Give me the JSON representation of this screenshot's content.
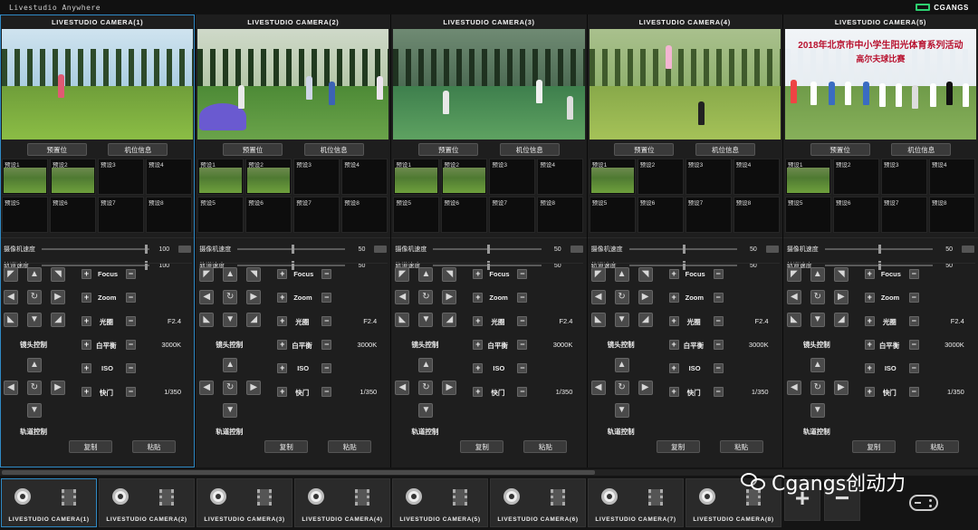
{
  "app": {
    "title": "Livestudio Anywhere",
    "brand": "CGANGS"
  },
  "cameras": [
    {
      "title": "LIVESTUDIO CAMERA(1)",
      "preset_btn": "预置位",
      "info_btn": "机位信息",
      "presets": [
        "预设1",
        "预设2",
        "预设3",
        "预设4",
        "预设5",
        "预设6",
        "预设7",
        "预设8"
      ],
      "speed_label": "摄像机速度",
      "speed_value": "100",
      "track_label": "轨道速度",
      "track_value": "100",
      "focus": "Focus",
      "zoom": "Zoom",
      "iris": "光圈",
      "iris_value": "F2.4",
      "wb": "白平衡",
      "wb_value": "3000K",
      "iso": "ISO",
      "shutter": "快门",
      "shutter_value": "1/350",
      "lens_ctrl": "镜头控制",
      "track_ctrl": "轨道控制",
      "copy": "复制",
      "paste": "粘贴"
    },
    {
      "title": "LIVESTUDIO CAMERA(2)",
      "preset_btn": "预置位",
      "info_btn": "机位信息",
      "presets": [
        "预设1",
        "预设2",
        "预设3",
        "预设4",
        "预设5",
        "预设6",
        "预设7",
        "预设8"
      ],
      "speed_label": "摄像机速度",
      "speed_value": "50",
      "track_label": "轨道速度",
      "track_value": "50",
      "focus": "Focus",
      "zoom": "Zoom",
      "iris": "光圈",
      "iris_value": "F2.4",
      "wb": "白平衡",
      "wb_value": "3000K",
      "iso": "ISO",
      "shutter": "快门",
      "shutter_value": "1/350",
      "lens_ctrl": "镜头控制",
      "track_ctrl": "轨道控制",
      "copy": "复制",
      "paste": "粘贴"
    },
    {
      "title": "LIVESTUDIO CAMERA(3)",
      "preset_btn": "预置位",
      "info_btn": "机位信息",
      "presets": [
        "预设1",
        "预设2",
        "预设3",
        "预设4",
        "预设5",
        "预设6",
        "预设7",
        "预设8"
      ],
      "speed_label": "摄像机速度",
      "speed_value": "50",
      "track_label": "轨道速度",
      "track_value": "50",
      "focus": "Focus",
      "zoom": "Zoom",
      "iris": "光圈",
      "iris_value": "F2.4",
      "wb": "白平衡",
      "wb_value": "3000K",
      "iso": "ISO",
      "shutter": "快门",
      "shutter_value": "1/350",
      "lens_ctrl": "镜头控制",
      "track_ctrl": "轨道控制",
      "copy": "复制",
      "paste": "粘贴"
    },
    {
      "title": "LIVESTUDIO CAMERA(4)",
      "preset_btn": "预置位",
      "info_btn": "机位信息",
      "presets": [
        "预设1",
        "预设2",
        "预设3",
        "预设4",
        "预设5",
        "预设6",
        "预设7",
        "预设8"
      ],
      "speed_label": "摄像机速度",
      "speed_value": "50",
      "track_label": "轨道速度",
      "track_value": "50",
      "focus": "Focus",
      "zoom": "Zoom",
      "iris": "光圈",
      "iris_value": "F2.4",
      "wb": "白平衡",
      "wb_value": "3000K",
      "iso": "ISO",
      "shutter": "快门",
      "shutter_value": "1/350",
      "lens_ctrl": "镜头控制",
      "track_ctrl": "轨道控制",
      "copy": "复制",
      "paste": "粘贴"
    },
    {
      "title": "LIVESTUDIO CAMERA(5)",
      "preset_btn": "预置位",
      "info_btn": "机位信息",
      "presets": [
        "预设1",
        "预设2",
        "预设3",
        "预设4",
        "预设5",
        "预设6",
        "预设7",
        "预设8"
      ],
      "speed_label": "摄像机速度",
      "speed_value": "50",
      "track_label": "轨道速度",
      "track_value": "50",
      "focus": "Focus",
      "zoom": "Zoom",
      "iris": "光圈",
      "iris_value": "F2.4",
      "wb": "白平衡",
      "wb_value": "3000K",
      "iso": "ISO",
      "shutter": "快门",
      "shutter_value": "1/350",
      "lens_ctrl": "镜头控制",
      "track_ctrl": "轨道控制",
      "copy": "复制",
      "paste": "粘贴",
      "banner_line1": "2018年北京市中小学生阳光体育系列活动",
      "banner_line2": "高尔夫球比赛"
    }
  ],
  "dock": {
    "tiles": [
      "LIVESTUDIO CAMERA(1)",
      "LIVESTUDIO CAMERA(2)",
      "LIVESTUDIO CAMERA(3)",
      "LIVESTUDIO CAMERA(4)",
      "LIVESTUDIO CAMERA(5)",
      "LIVESTUDIO CAMERA(6)",
      "LIVESTUDIO CAMERA(7)",
      "LIVESTUDIO CAMERA(8)"
    ],
    "add": "+",
    "remove": "−"
  },
  "watermark": "Cgangs创动力",
  "colors": {
    "accent": "#2f8ac5",
    "brand": "#2ed070",
    "panel": "#1e1e1e"
  }
}
